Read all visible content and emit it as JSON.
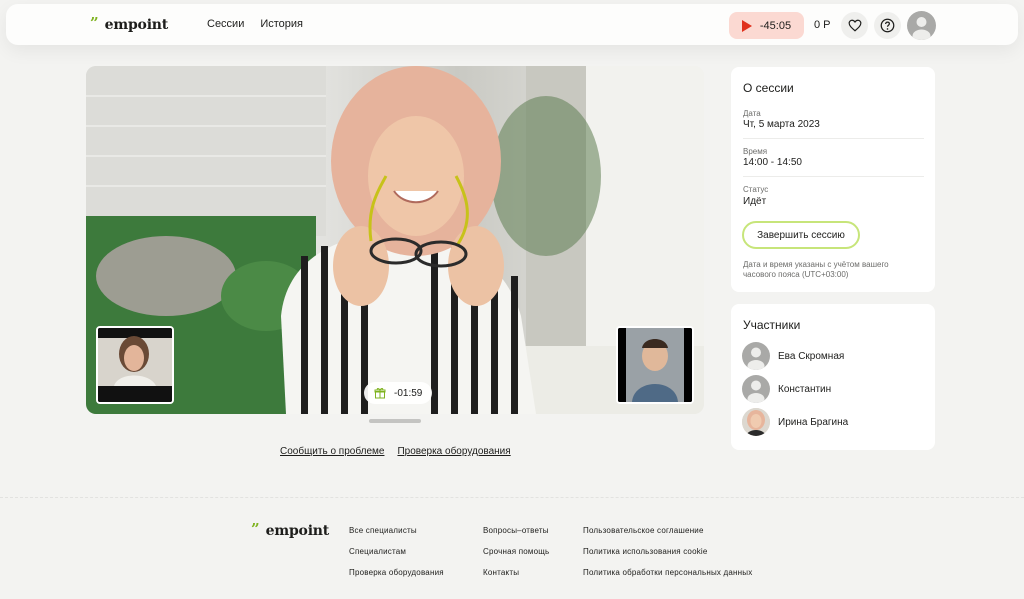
{
  "header": {
    "logo": {
      "mark": "”",
      "text": "empoint"
    },
    "nav": [
      "Сессии",
      "История"
    ],
    "timer": "-45:05",
    "balance": "0 Р",
    "icons": [
      "heart-icon",
      "help-icon",
      "user-avatar"
    ]
  },
  "video": {
    "session_timer": "-01:59",
    "links": [
      "Сообщить о проблеме",
      "Проверка оборудования"
    ]
  },
  "about": {
    "title": "О сессии",
    "fields": [
      {
        "label": "Дата",
        "value": "Чт, 5 марта 2023"
      },
      {
        "label": "Время",
        "value": "14:00 - 14:50"
      },
      {
        "label": "Статус",
        "value": "Идёт"
      }
    ],
    "button": "Завершить сессию",
    "note": "Дата и время указаны с учётом вашего часового пояса (UTC+03:00)"
  },
  "participants": {
    "title": "Участники",
    "list": [
      {
        "name": "Ева Скромная"
      },
      {
        "name": "Константин"
      },
      {
        "name": "Ирина Брагина"
      }
    ]
  },
  "footer": {
    "logo": {
      "mark": "”",
      "text": "empoint"
    },
    "col1": [
      "Все специалисты",
      "Специалистам",
      "Проверка оборудования"
    ],
    "col2": [
      "Вопросы–ответы",
      "Срочная помощь",
      "Контакты"
    ],
    "col3": [
      "Пользовательское соглашение",
      "Политика использования cookie",
      "Политика обработки персональных данных"
    ]
  },
  "colors": {
    "accent_green": "#7fb320",
    "timer_bg": "#fbd9d2",
    "timer_play": "#e0301c",
    "button_border": "#c7e57a"
  }
}
